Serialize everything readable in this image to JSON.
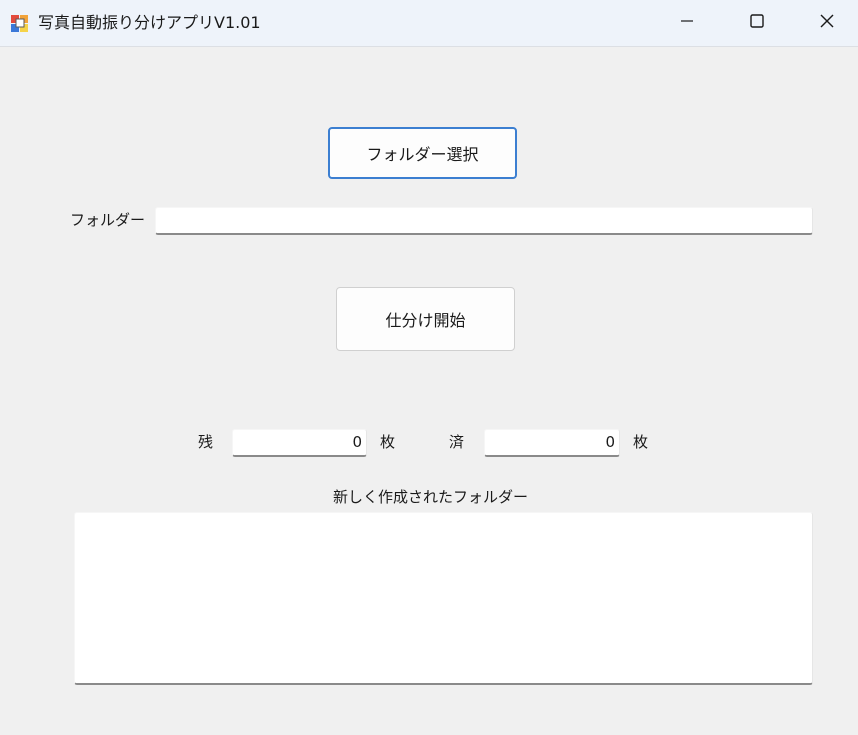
{
  "window": {
    "title": "写真自動振り分けアプリV1.01",
    "icon": "app-icon",
    "controls": [
      "minimize-icon",
      "maximize-icon",
      "close-icon"
    ]
  },
  "buttons": {
    "select_folder": "フォルダー選択",
    "start_sorting": "仕分け開始"
  },
  "folder": {
    "label": "フォルダー",
    "value": ""
  },
  "counts": {
    "remaining_label": "残",
    "remaining_value": "0",
    "unit": "枚",
    "done_label": "済",
    "done_value": "0"
  },
  "new_folders": {
    "label": "新しく作成されたフォルダー",
    "items": []
  },
  "colors": {
    "background": "#f0f0f0",
    "titlebar": "#eef3fa",
    "focus_accent": "#3c7fd1"
  }
}
